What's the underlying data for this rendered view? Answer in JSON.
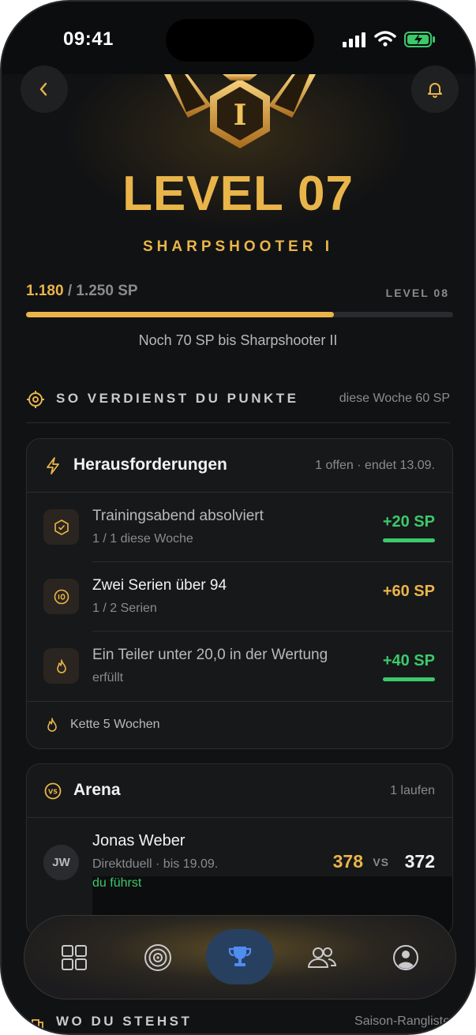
{
  "status_bar": {
    "time": "09:41"
  },
  "header": {
    "level_title": "LEVEL 07",
    "rank_name": "SHARPSHOOTER I",
    "badge_numeral": "I"
  },
  "progress": {
    "current": "1.180",
    "separator": " / ",
    "max": "1.250 SP",
    "next_level": "LEVEL 08",
    "fraction": 0.72,
    "note": "Noch 70 SP bis Sharpshooter II"
  },
  "earn_section": {
    "label": "SO VERDIENST DU PUNKTE",
    "meta": "diese Woche 60 SP"
  },
  "challenges": {
    "title": "Herausforderungen",
    "meta": "1 offen · endet 13.09.",
    "items": [
      {
        "name": "Trainingsabend absolviert",
        "sub": "1 / 1 diese Woche",
        "points": "+20 SP",
        "completed": true
      },
      {
        "name": "Zwei Serien über 94",
        "sub": "1 / 2 Serien",
        "points": "+60 SP",
        "completed": false
      },
      {
        "name": "Ein Teiler unter 20,0 in der Wertung",
        "sub": "erfüllt",
        "points": "+40 SP",
        "completed": true
      }
    ],
    "streak": "Kette 5 Wochen"
  },
  "arena": {
    "title": "Arena",
    "meta": "1 laufen",
    "duel": {
      "initials": "JW",
      "name": "Jonas Weber",
      "sub": "Direktduell · bis 19.09.",
      "status": "du führst",
      "score_me": "378",
      "vs": "VS",
      "score_opponent": "372"
    }
  },
  "standing_section": {
    "label": "WO DU STEHST",
    "meta": "Saison-Rangliste"
  },
  "tabbar": {
    "tabs": [
      "dashboard-icon",
      "target-icon",
      "trophy-icon",
      "people-icon",
      "profile-icon"
    ],
    "active_index": 2
  },
  "colors": {
    "gold": "#e9b54a",
    "green": "#3cc96a",
    "background": "#111214",
    "active_tab": "#27405f"
  }
}
